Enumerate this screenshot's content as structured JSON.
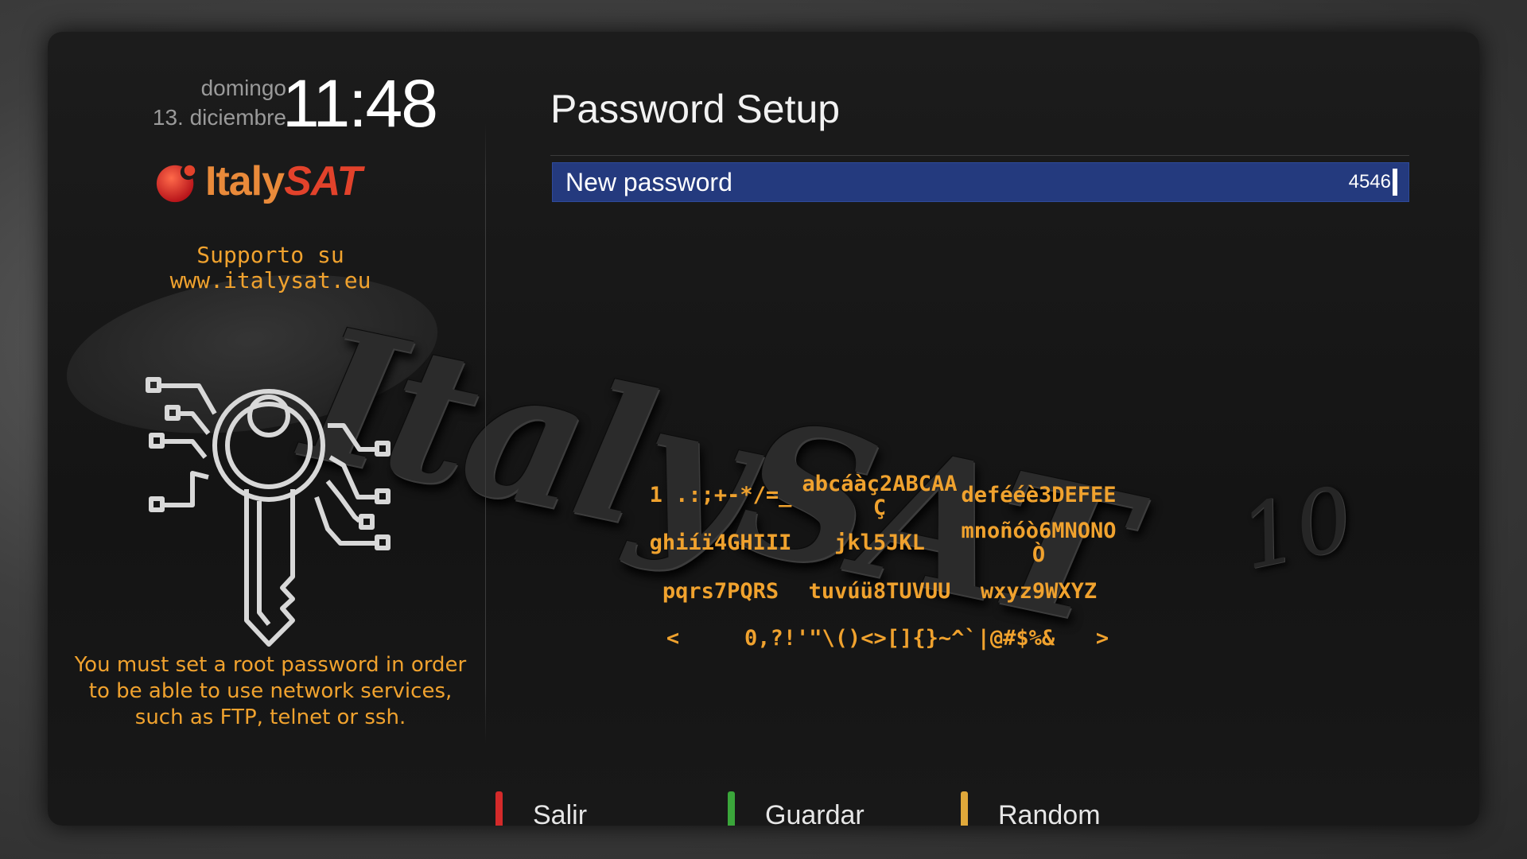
{
  "clock": {
    "day": "domingo",
    "date": "13. diciembre",
    "time": "11:48"
  },
  "brand": {
    "name_part1": "Italy",
    "name_part2": "SAT",
    "support_line1": "Supporto su",
    "support_line2": "www.italysat.eu",
    "watermark": "ItalySAT",
    "watermark_version": "10"
  },
  "sidebar": {
    "note": "You must set a root password in order to be able to use network services, such as FTP, telnet or ssh."
  },
  "screen": {
    "title": "Password Setup"
  },
  "password_field": {
    "label": "New password",
    "value": "4546"
  },
  "keypad": {
    "keys": [
      [
        "1 .:;+-*/=_",
        "abcáàç2ABCAA\nÇ",
        "defééè3DEFEE"
      ],
      [
        "ghiíï4GHIII",
        "jkl5JKL",
        "mnoñóò6MNONO\nÒ"
      ],
      [
        "pqrs7PQRS",
        "tuvúü8TUVUU",
        "wxyz9WXYZ"
      ]
    ],
    "bottom_left": "<",
    "bottom_middle": "0,?!'\"\\()<>[]{}~^`|@#$%&",
    "bottom_right": ">"
  },
  "buttons": [
    {
      "label": "Salir",
      "color": "#d42a2a"
    },
    {
      "label": "Guardar",
      "color": "#3aa63a"
    },
    {
      "label": "Random",
      "color": "#e0a83a"
    }
  ]
}
